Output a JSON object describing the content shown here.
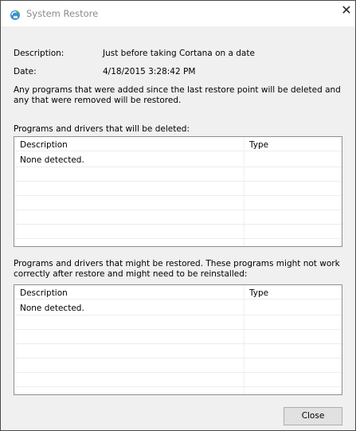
{
  "window": {
    "title": "System Restore",
    "close_glyph": "✕"
  },
  "details": {
    "description_label": "Description:",
    "description_value": "Just before taking Cortana on a date",
    "date_label": "Date:",
    "date_value": "4/18/2015 3:28:42 PM",
    "info_text": "Any programs that were added since the last restore point will be deleted and any that were removed will be restored."
  },
  "deleted": {
    "heading": "Programs and drivers that will be deleted:",
    "columns": [
      "Description",
      "Type"
    ],
    "rows": [
      {
        "description": "None detected.",
        "type": ""
      }
    ]
  },
  "restored": {
    "heading": "Programs and drivers that might be restored. These programs might not work correctly after restore and might need to be reinstalled:",
    "columns": [
      "Description",
      "Type"
    ],
    "rows": [
      {
        "description": "None detected.",
        "type": ""
      }
    ]
  },
  "buttons": {
    "close_label": "Close"
  },
  "colors": {
    "title_text": "#8a8a8a",
    "window_bg": "#f0f0f0",
    "list_border": "#8f8f8f"
  }
}
